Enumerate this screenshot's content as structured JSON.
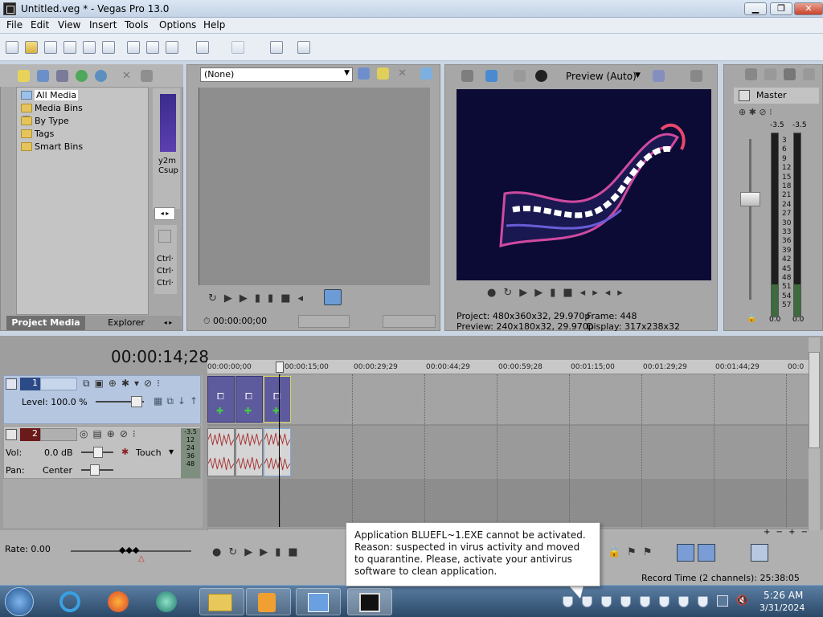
{
  "window": {
    "title": "Untitled.veg * - Vegas Pro 13.0"
  },
  "menu": [
    "File",
    "Edit",
    "View",
    "Insert",
    "Tools",
    "Options",
    "Help"
  ],
  "project_media": {
    "tree": [
      "All Media",
      "Media Bins",
      "By Type",
      "Tags",
      "Smart Bins"
    ],
    "expand_marker": "+",
    "thumb_label_1": "y2m",
    "thumb_label_2": "Csup",
    "side_labels": [
      "Ctrl·",
      "Ctrl·",
      "Ctrl·"
    ],
    "tabs": [
      "Project Media",
      "Explorer"
    ]
  },
  "trimmer": {
    "dropdown": "(None)",
    "timecode": "00:00:00;00"
  },
  "preview": {
    "mode": "Preview (Auto)",
    "project_label": "Project:",
    "project_value": "480x360x32, 29.970p",
    "preview_label": "Preview:",
    "preview_value": "240x180x32, 29.970p",
    "frame_label": "Frame:",
    "frame_value": "448",
    "display_label": "Display:",
    "display_value": "317x238x32"
  },
  "mixer": {
    "title": "Master",
    "peak_left": "-3.5",
    "peak_right": "-3.5",
    "scale": [
      "3",
      "6",
      "9",
      "12",
      "15",
      "18",
      "21",
      "24",
      "27",
      "30",
      "33",
      "36",
      "39",
      "42",
      "45",
      "48",
      "51",
      "54",
      "57"
    ],
    "bottom_left": "0.0",
    "bottom_right": "0.0"
  },
  "timeline": {
    "cursor_time": "00:00:14;28",
    "ruler": [
      "00:00:00;00",
      "00:00:15;00",
      "00:00:29;29",
      "00:00:44;29",
      "00:00:59;28",
      "00:01:15;00",
      "00:01:29;29",
      "00:01:44;29",
      "00:0"
    ],
    "video_track": {
      "number": "1",
      "level": "Level: 100.0 %"
    },
    "audio_track": {
      "number": "2",
      "vol_label": "Vol:",
      "vol_value": "0.0 dB",
      "pan_label": "Pan:",
      "pan_value": "Center",
      "mode": "Touch",
      "meter_peak": "-3.5",
      "meter_scale": [
        "12",
        "24",
        "36",
        "48"
      ]
    },
    "rate": "Rate: 0.00"
  },
  "status": {
    "record_time": "Record Time (2 channels): 25:38:05"
  },
  "notification": {
    "text": "Application BLUEFL~1.EXE cannot be activated. Reason: suspected in virus activity and moved to quarantine. Please, activate your antivirus software to clean application."
  },
  "taskbar": {
    "time": "5:26 AM",
    "date": "3/31/2024"
  }
}
